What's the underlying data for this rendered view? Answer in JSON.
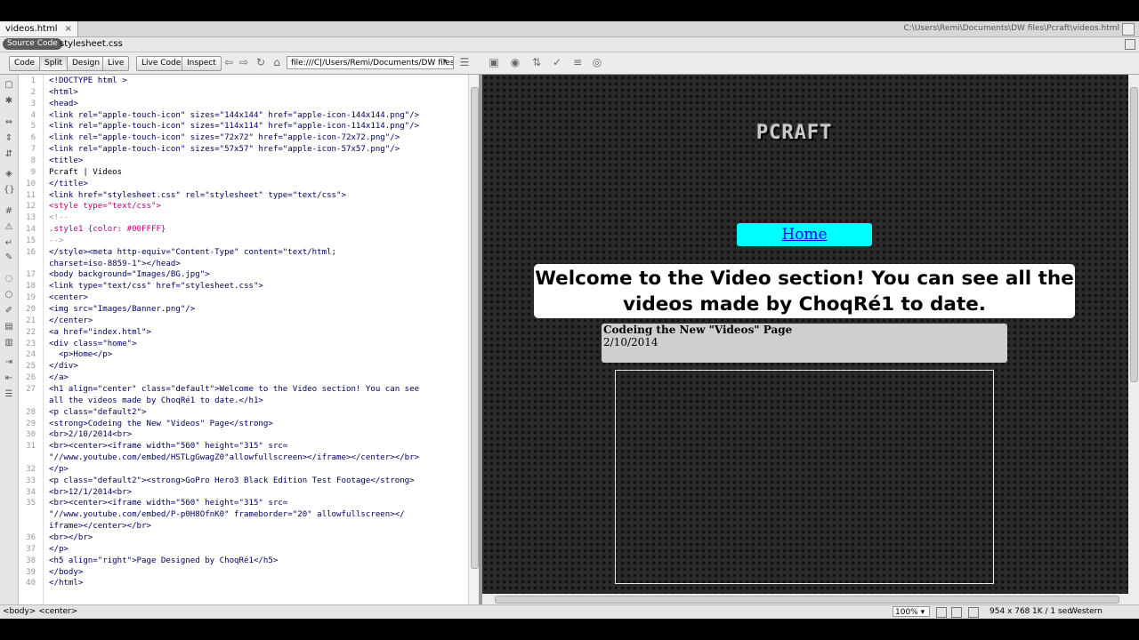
{
  "tab": {
    "filename": "videos.html",
    "close": "×",
    "path": "C:\\Users\\Remi\\Documents\\DW files\\Pcraft\\videos.html"
  },
  "related": {
    "source_code": "Source Code",
    "stylesheet": "stylesheet.css"
  },
  "toolbar": {
    "code": "Code",
    "split": "Split",
    "design": "Design",
    "live": "Live",
    "live_code": "Live Code",
    "inspect": "Inspect",
    "url": "file:///C|/Users/Remi/Documents/DW files/Pcra"
  },
  "icons": {
    "back": "⇦",
    "forward": "⇨",
    "refresh": "↻",
    "home": "⌂",
    "url_dropdown": "▾",
    "browser_nav": "☰"
  },
  "code_lines": [
    {
      "n": "1",
      "t": "<!DOCTYPE html >",
      "k": "tag"
    },
    {
      "n": "2",
      "t": "<html>",
      "k": "tag"
    },
    {
      "n": "3",
      "t": "<head>",
      "k": "tag"
    },
    {
      "n": "4",
      "t": "<link rel=\"apple-touch-icon\" sizes=\"144x144\" href=\"apple-icon-144x144.png\"/>",
      "k": "tag"
    },
    {
      "n": "5",
      "t": "<link rel=\"apple-touch-icon\" sizes=\"114x114\" href=\"apple-icon-114x114.png\"/>",
      "k": "tag"
    },
    {
      "n": "6",
      "t": "<link rel=\"apple-touch-icon\" sizes=\"72x72\" href=\"apple-icon-72x72.png\"/>",
      "k": "tag"
    },
    {
      "n": "7",
      "t": "<link rel=\"apple-touch-icon\" sizes=\"57x57\" href=\"apple-icon-57x57.png\"/>",
      "k": "tag"
    },
    {
      "n": "8",
      "t": "<title>",
      "k": "tag"
    },
    {
      "n": "9",
      "t": "Pcraft | Videos",
      "k": "txt"
    },
    {
      "n": "10",
      "t": "</title>",
      "k": "tag"
    },
    {
      "n": "11",
      "t": "<link href=\"stylesheet.css\" rel=\"stylesheet\" type=\"text/css\">",
      "k": "tag"
    },
    {
      "n": "12",
      "t": "<style type=\"text/css\">",
      "k": "css"
    },
    {
      "n": "13",
      "t": "<!--",
      "k": "cmt"
    },
    {
      "n": "14",
      "t": ".style1 {color: #00FFFF}",
      "k": "css"
    },
    {
      "n": "15",
      "t": "-->",
      "k": "cmt"
    },
    {
      "n": "16",
      "t": "</style><meta http-equiv=\"Content-Type\" content=\"text/html;",
      "k": "tag"
    },
    {
      "n": "",
      "t": "charset=iso-8859-1\"></head>",
      "k": "tag"
    },
    {
      "n": "17",
      "t": "<body background=\"Images/BG.jpg\">",
      "k": "tag"
    },
    {
      "n": "18",
      "t": "<link type=\"text/css\" href=\"stylesheet.css\">",
      "k": "tag"
    },
    {
      "n": "19",
      "t": "<center>",
      "k": "tag"
    },
    {
      "n": "20",
      "t": "<img src=\"Images/Banner.png\"/>",
      "k": "tag"
    },
    {
      "n": "21",
      "t": "</center>",
      "k": "tag"
    },
    {
      "n": "22",
      "t": "<a href=\"index.html\">",
      "k": "tag"
    },
    {
      "n": "23",
      "t": "<div class=\"home\">",
      "k": "tag"
    },
    {
      "n": "24",
      "t": "  <p>Home</p>",
      "k": "tag"
    },
    {
      "n": "25",
      "t": "</div>",
      "k": "tag"
    },
    {
      "n": "26",
      "t": "</a>",
      "k": "tag"
    },
    {
      "n": "27",
      "t": "<h1 align=\"center\" class=\"default\">Welcome to the Video section! You can see",
      "k": "tag"
    },
    {
      "n": "",
      "t": "all the videos made by ChoqRé1 to date.</h1>",
      "k": "tag"
    },
    {
      "n": "28",
      "t": "<p class=\"default2\">",
      "k": "tag"
    },
    {
      "n": "29",
      "t": "<strong>Codeing the New \"Videos\" Page</strong>",
      "k": "tag"
    },
    {
      "n": "30",
      "t": "<br>2/10/2014<br>",
      "k": "tag"
    },
    {
      "n": "31",
      "t": "<br><center><iframe width=\"560\" height=\"315\" src=",
      "k": "tag"
    },
    {
      "n": "",
      "t": "\"//www.youtube.com/embed/HSTLgGwagZ0\"allowfullscreen></iframe></center></br>",
      "k": "tag"
    },
    {
      "n": "32",
      "t": "</p>",
      "k": "tag"
    },
    {
      "n": "33",
      "t": "<p class=\"default2\"><strong>GoPro Hero3 Black Edition Test Footage</strong>",
      "k": "tag"
    },
    {
      "n": "34",
      "t": "<br>12/1/2014<br>",
      "k": "tag"
    },
    {
      "n": "35",
      "t": "<br><center><iframe width=\"560\" height=\"315\" src=",
      "k": "tag"
    },
    {
      "n": "",
      "t": "\"//www.youtube.com/embed/P-p0H8OfnK0\" frameborder=\"20\" allowfullscreen></",
      "k": "tag"
    },
    {
      "n": "",
      "t": "iframe></center></br>",
      "k": "tag"
    },
    {
      "n": "36",
      "t": "<br></br>",
      "k": "tag"
    },
    {
      "n": "37",
      "t": "</p>",
      "k": "tag"
    },
    {
      "n": "38",
      "t": "<h5 align=\"right\">Page Designed by ChoqRé1</h5>",
      "k": "tag"
    },
    {
      "n": "39",
      "t": "</body>",
      "k": "tag"
    },
    {
      "n": "40",
      "t": "</html>",
      "k": "tag"
    }
  ],
  "design": {
    "banner": "PCRAFT",
    "home": "Home",
    "welcome": "Welcome to the Video section! You can see all the videos made by ChoqRé1 to date.",
    "entry_title": "Codeing the New \"Videos\" Page",
    "entry_date": "2/10/2014"
  },
  "status": {
    "tag_selector": "<body> <center>",
    "zoom": "100%",
    "zoom_dropdown": "▾",
    "dimensions": "954 x 768",
    "file_size": "1K / 1 sec",
    "encoding": "Western European"
  },
  "colors": {
    "home_bg": "#00ffff",
    "link": "#0000ee",
    "design_bg": "#2a2a2a"
  }
}
